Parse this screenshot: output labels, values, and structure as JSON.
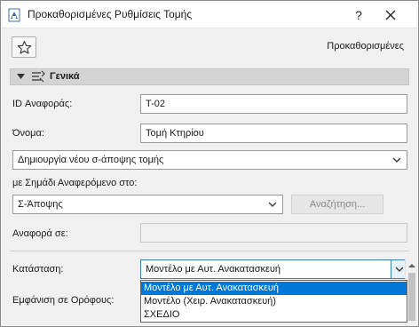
{
  "window": {
    "title": "Προκαθορισμένες Ρυθμίσεις Τομής",
    "help_glyph": "?",
    "close_icon": "close-icon",
    "app_icon": "archicad-app-icon"
  },
  "favorites": {
    "star_icon": "star-icon",
    "presets_label": "Προκαθορισμένες"
  },
  "section": {
    "title": "Γενικά",
    "expanded": true,
    "icon": "section-settings-icon",
    "tri_icon": "triangle-down-icon"
  },
  "fields": {
    "reference_id": {
      "label": "ID Αναφοράς:",
      "value": "T-02"
    },
    "name": {
      "label": "Όνομα:",
      "value": "Τομή Κτηρίου"
    },
    "view_creation": {
      "value": "Δημιουργία νέου σ-άποψης τομής"
    },
    "marker_ref": {
      "label": "με Σημάδι Αναφερόμενο στο:",
      "value": "Σ-Άποψης"
    },
    "browse_button": "Αναζήτηση...",
    "reference_to": {
      "label": "Αναφορά σε:",
      "value": ""
    },
    "status": {
      "label": "Κατάσταση:",
      "value": "Μοντέλο με Αυτ. Ανακατασκευή"
    },
    "show_on_stories": {
      "label": "Εμφάνιση σε Ορόφους:"
    }
  },
  "status_dropdown": {
    "options": [
      "Μοντέλο με Αυτ. Ανακατασκευή",
      "Μοντέλο (Χειρ. Ανακατασκευή)",
      "ΣΧΕΔΙΟ"
    ],
    "selected_index": 0
  },
  "colors": {
    "selection": "#0078d7",
    "section_header": "#d4d4d4",
    "window_bg": "#f0f0f0"
  }
}
